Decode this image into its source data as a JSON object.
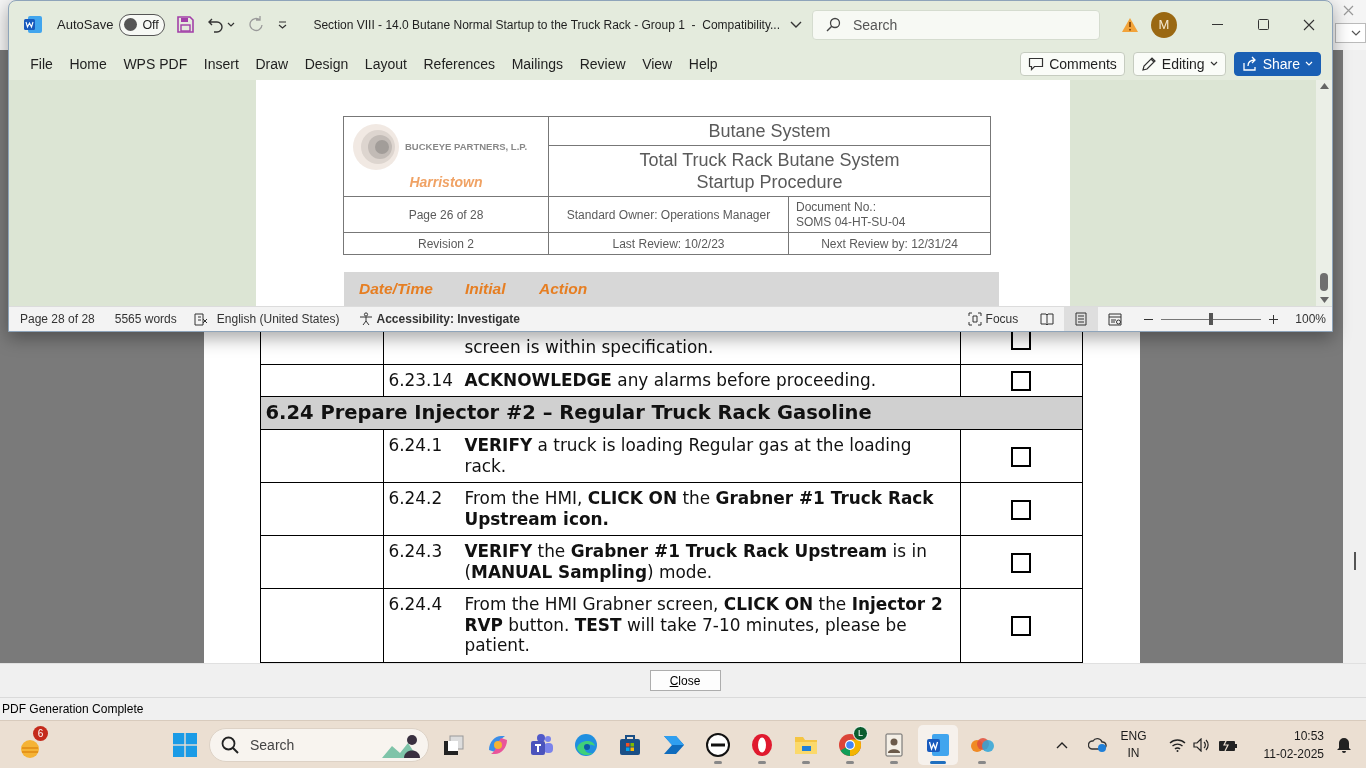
{
  "word_window": {
    "autosave": {
      "label": "AutoSave",
      "state": "Off",
      "on": false
    },
    "title": "Section VIII - 14.0 Butane Normal Startup to the Truck Rack - Group 1  -  Compatibility...",
    "search": {
      "placeholder": "Search"
    },
    "avatar": "M",
    "ribbon_tabs": [
      "File",
      "Home",
      "WPS PDF",
      "Insert",
      "Draw",
      "Design",
      "Layout",
      "References",
      "Mailings",
      "Review",
      "View",
      "Help"
    ],
    "ribbon_buttons": [
      {
        "label": "Comments",
        "kind": "comments"
      },
      {
        "label": "Editing",
        "kind": "editing"
      },
      {
        "label": "Share",
        "kind": "share"
      }
    ],
    "document": {
      "header": {
        "company": "BUCKEYE PARTNERS, L.P.",
        "site": "Harristown",
        "system": "Butane System",
        "procedure": "Total Truck Rack Butane System Startup Procedure",
        "page": "Page 26 of 28",
        "owner": "Standard Owner: Operations Manager",
        "doc_no_label": "Document No.:",
        "doc_no": "SOMS 04-HT-SU-04",
        "revision": "Revision 2",
        "last_review": "Last Review: 10/2/23",
        "next_review": "Next Review by: 12/31/24"
      },
      "log_columns": [
        "Date/Time",
        "Initial",
        "Action"
      ]
    },
    "status_bar": {
      "page": "Page 28 of 28",
      "words": "5565 words",
      "language": "English (United States)",
      "accessibility": "Accessibility: Investigate",
      "focus": "Focus",
      "views": [
        {
          "kind": "read",
          "selected": false
        },
        {
          "kind": "print",
          "selected": true
        },
        {
          "kind": "web",
          "selected": false
        }
      ],
      "zoom_slider": {
        "level": 0.5
      },
      "zoom": "100%"
    }
  },
  "pdf_viewer": {
    "rows": [
      {
        "kind": "step",
        "text": "screen is within specification.",
        "checked": false
      },
      {
        "kind": "step",
        "number": "6.23.14",
        "text": "**ACKNOWLEDGE** any alarms before proceeding.",
        "checked": false
      },
      {
        "kind": "section",
        "text": "6.24 Prepare Injector #2 – Regular Truck Rack Gasoline"
      },
      {
        "kind": "step",
        "number": "6.24.1",
        "text": "**VERIFY** a truck is loading Regular gas at the loading rack.",
        "checked": false
      },
      {
        "kind": "step",
        "number": "6.24.2",
        "text": "From the HMI, **CLICK ON** the **Grabner #1 Truck Rack Upstream icon.**",
        "checked": false
      },
      {
        "kind": "step",
        "number": "6.24.3",
        "text": "**VERIFY** the **Grabner #1 Truck Rack Upstream** is in (**MANUAL Sampling**) mode.",
        "checked": false
      },
      {
        "kind": "step",
        "number": "6.24.4",
        "text": "From the HMI Grabner screen, **CLICK ON** the **Injector 2 RVP** button. **TEST** will take 7-10 minutes, please be patient.",
        "checked": false
      }
    ],
    "close_button": "Close",
    "status": "PDF Generation Complete"
  },
  "taskbar": {
    "widgets_badge": "6",
    "search": {
      "placeholder": "Search"
    },
    "apps": [
      {
        "kind": "taskview",
        "running": false,
        "active": false
      },
      {
        "kind": "copilot",
        "running": false,
        "active": false
      },
      {
        "kind": "teams",
        "running": false,
        "active": false
      },
      {
        "kind": "edge",
        "running": false,
        "active": false
      },
      {
        "kind": "store",
        "running": false,
        "active": false
      },
      {
        "kind": "automate",
        "running": false,
        "active": false
      },
      {
        "kind": "dell",
        "running": true,
        "active": false
      },
      {
        "kind": "opera",
        "running": true,
        "active": false
      },
      {
        "kind": "explorer",
        "running": true,
        "active": false
      },
      {
        "kind": "chrome",
        "running": true,
        "active": false,
        "badge": "L"
      },
      {
        "kind": "portrait",
        "running": true,
        "active": false
      },
      {
        "kind": "word",
        "running": true,
        "active": true
      },
      {
        "kind": "blobs",
        "running": true,
        "active": false
      }
    ],
    "language": "ENG",
    "region": "IN",
    "time": "10:53",
    "date": "11-02-2025"
  }
}
